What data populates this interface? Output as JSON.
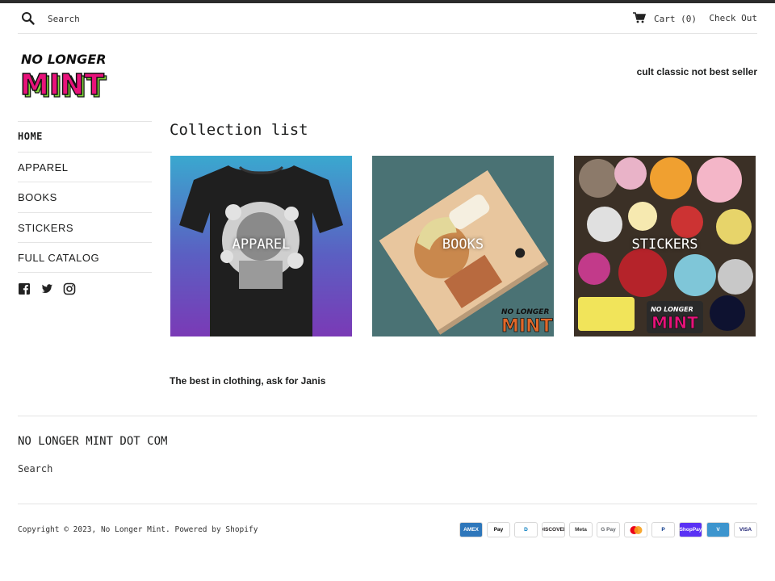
{
  "header": {
    "search_placeholder": "Search",
    "cart_label": "Cart (0)",
    "checkout_label": "Check Out"
  },
  "brand": {
    "logo_line1": "NO LONGER",
    "logo_line2": "MINT",
    "tagline": "cult classic not best seller"
  },
  "sidebar": {
    "items": [
      {
        "label": "HOME"
      },
      {
        "label": "APPAREL"
      },
      {
        "label": "BOOKS"
      },
      {
        "label": "STICKERS"
      },
      {
        "label": "FULL CATALOG"
      }
    ],
    "social_icons": [
      "facebook-icon",
      "twitter-icon",
      "instagram-icon"
    ]
  },
  "main": {
    "title": "Collection list",
    "collections": [
      {
        "label": "APPAREL"
      },
      {
        "label": "BOOKS"
      },
      {
        "label": "STICKERS"
      }
    ],
    "blurb": "The best in clothing, ask for Janis"
  },
  "footer": {
    "title": "NO LONGER MINT DOT COM",
    "search_link": "Search",
    "copyright_prefix": "Copyright © 2023, ",
    "copyright_store": "No Longer Mint",
    "copyright_suffix": ". ",
    "powered_by": "Powered by Shopify",
    "payment_methods": [
      {
        "name": "AMEX",
        "bg": "#2e77bb",
        "fg": "#ffffff"
      },
      {
        "name": "Pay",
        "bg": "#ffffff",
        "fg": "#000000"
      },
      {
        "name": "D",
        "bg": "#ffffff",
        "fg": "#0079be"
      },
      {
        "name": "DISCOVER",
        "bg": "#ffffff",
        "fg": "#231f20"
      },
      {
        "name": "Meta",
        "bg": "#ffffff",
        "fg": "#333333"
      },
      {
        "name": "G Pay",
        "bg": "#ffffff",
        "fg": "#5f6368"
      },
      {
        "name": "",
        "bg": "#ffffff",
        "fg": "#eb001b"
      },
      {
        "name": "P",
        "bg": "#ffffff",
        "fg": "#003087"
      },
      {
        "name": "ShopPay",
        "bg": "#5a31f4",
        "fg": "#ffffff"
      },
      {
        "name": "V",
        "bg": "#3d95ce",
        "fg": "#ffffff"
      },
      {
        "name": "VISA",
        "bg": "#ffffff",
        "fg": "#1a1f71"
      }
    ]
  },
  "colors": {
    "text": "#1c1d1d",
    "border": "#e4e4e4",
    "logo_pink": "#e8127a",
    "logo_green": "#7fd23a"
  }
}
